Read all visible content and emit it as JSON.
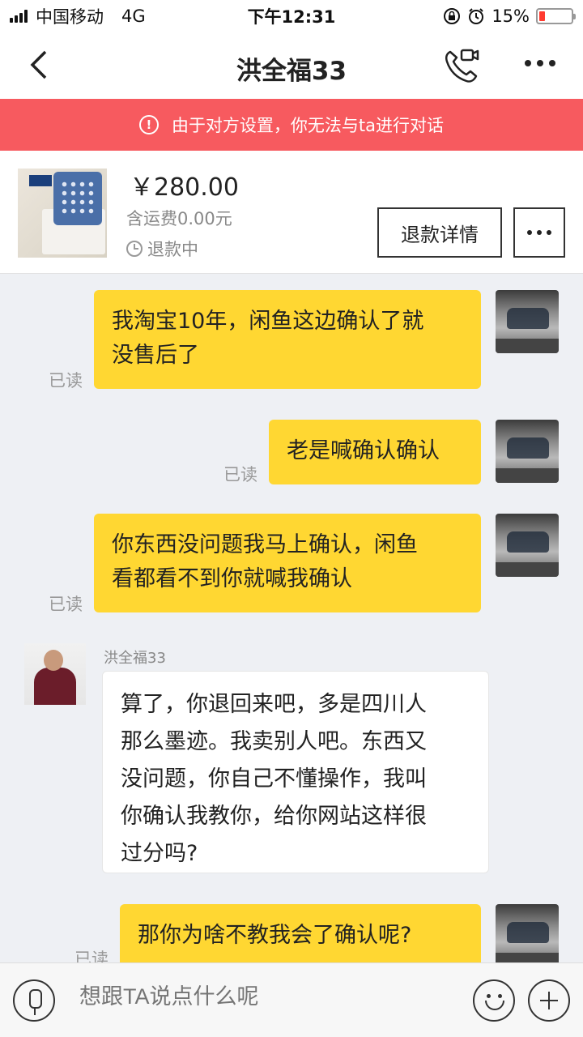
{
  "status_bar": {
    "carrier": "中国移动",
    "network": "4G",
    "time": "下午12:31",
    "battery": "15%"
  },
  "header": {
    "title": "洪全福33"
  },
  "alert": {
    "text": "由于对方设置，你无法与ta进行对话"
  },
  "product": {
    "price": "￥280.00",
    "shipping": "含运费0.00元",
    "status": "退款中",
    "refund_button": "退款详情"
  },
  "messages": [
    {
      "side": "me",
      "text_line1": "我淘宝10年，闲鱼这边确认了就",
      "text_line2": "没售后了",
      "read": "已读"
    },
    {
      "side": "me",
      "text_line1": "老是喊确认确认",
      "read": "已读"
    },
    {
      "side": "me",
      "text_line1": "你东西没问题我马上确认，闲鱼",
      "text_line2": "看都看不到你就喊我确认",
      "read": "已读"
    },
    {
      "side": "other",
      "sender": "洪全福33",
      "lines": [
        "算了，你退回来吧，多是四川人",
        "那么墨迹。我卖别人吧。东西又",
        "没问题，你自己不懂操作，我叫",
        "你确认我教你，给你网站这样很",
        "过分吗?"
      ]
    },
    {
      "side": "me",
      "text_line1": "那你为啥不教我会了确认呢?",
      "read": "已读"
    }
  ],
  "input": {
    "placeholder": "想跟TA说点什么呢"
  }
}
